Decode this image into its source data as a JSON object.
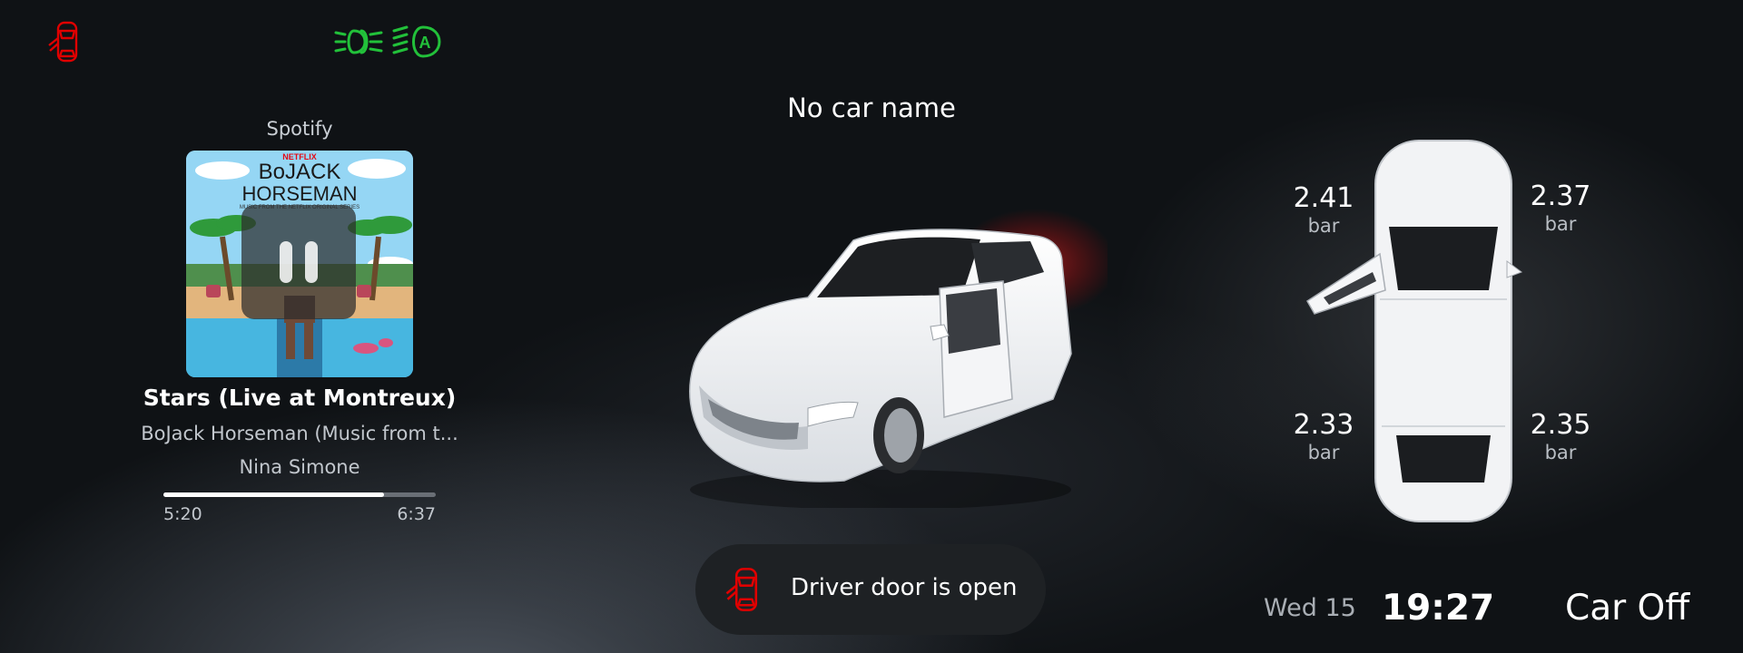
{
  "indicators": {
    "door_warning_icon": "car-door-open-icon",
    "headlights_icon": "low-beam-headlights-icon",
    "auto_headlights_icon": "auto-headlights-icon",
    "warning_color": "#e00000",
    "lights_color": "#22c13a"
  },
  "media": {
    "source": "Spotify",
    "track_title": "Stars (Live at Montreux)",
    "album": "BoJack Horseman (Music from t...",
    "artist": "Nina Simone",
    "elapsed": "5:20",
    "total": "6:37",
    "progress": 0.81,
    "playback_control_icon": "pause-icon",
    "cover_art": {
      "brand": "NETFLIX",
      "title_line1": "BoJACK",
      "title_line2": "HORSEMAN",
      "subtitle": "MUSIC FROM THE NETFLIX ORIGINAL SERIES"
    }
  },
  "car": {
    "name": "No car name",
    "door_alert_text": "Driver door is open",
    "door_alert_icon": "car-door-open-icon"
  },
  "tires": {
    "front_left": {
      "value": "2.41",
      "unit": "bar"
    },
    "front_right": {
      "value": "2.37",
      "unit": "bar"
    },
    "rear_left": {
      "value": "2.33",
      "unit": "bar"
    },
    "rear_right": {
      "value": "2.35",
      "unit": "bar"
    }
  },
  "status": {
    "date": "Wed 15",
    "time": "19:27",
    "car_state": "Car Off"
  }
}
